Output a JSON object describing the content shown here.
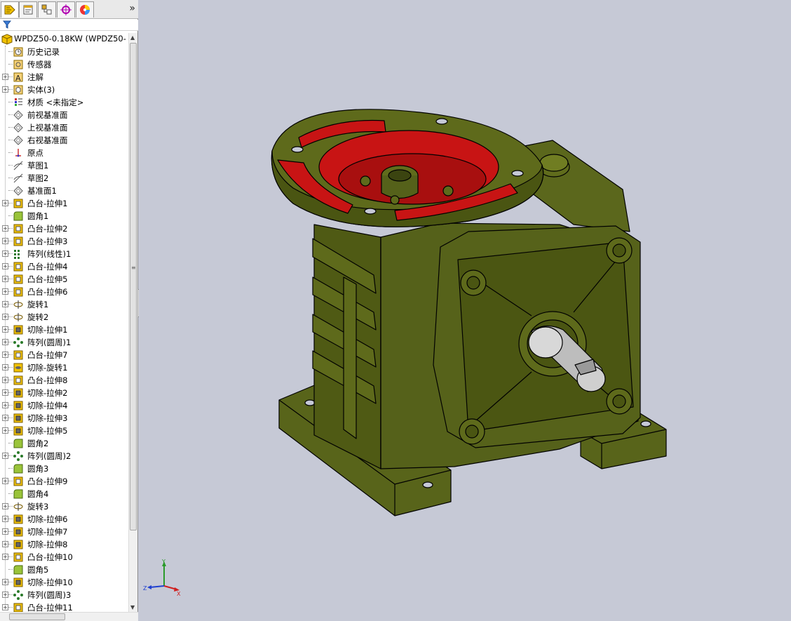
{
  "tabs": [
    {
      "name": "feature-manager",
      "icon": "feature-tree-icon"
    },
    {
      "name": "property-manager",
      "icon": "property-manager-icon"
    },
    {
      "name": "configuration-manager",
      "icon": "configuration-manager-icon"
    },
    {
      "name": "dimxpert-manager",
      "icon": "dimxpert-icon"
    },
    {
      "name": "display-manager",
      "icon": "display-manager-icon"
    }
  ],
  "tabs_more": "»",
  "filter_icon": "filter-icon",
  "tree": {
    "root": {
      "label": "WPDZ50-0.18KW  (WPDZ50-",
      "icon": "part-icon"
    },
    "items": [
      {
        "label": "历史记录",
        "icon": "history-icon",
        "expandable": false
      },
      {
        "label": "传感器",
        "icon": "sensor-icon",
        "expandable": false
      },
      {
        "label": "注解",
        "icon": "annotation-icon",
        "expandable": true
      },
      {
        "label": "实体(3)",
        "icon": "solid-bodies-icon",
        "expandable": true
      },
      {
        "label": "材质 <未指定>",
        "icon": "material-icon",
        "expandable": false
      },
      {
        "label": "前视基准面",
        "icon": "plane-icon",
        "expandable": false
      },
      {
        "label": "上视基准面",
        "icon": "plane-icon",
        "expandable": false
      },
      {
        "label": "右视基准面",
        "icon": "plane-icon",
        "expandable": false
      },
      {
        "label": "原点",
        "icon": "origin-icon",
        "expandable": false
      },
      {
        "label": "草图1",
        "icon": "sketch-icon",
        "expandable": false
      },
      {
        "label": "草图2",
        "icon": "sketch-icon",
        "expandable": false
      },
      {
        "label": "基准面1",
        "icon": "plane-icon",
        "expandable": false
      },
      {
        "label": "凸台-拉伸1",
        "icon": "boss-extrude-icon",
        "expandable": true
      },
      {
        "label": "圆角1",
        "icon": "fillet-icon",
        "expandable": false
      },
      {
        "label": "凸台-拉伸2",
        "icon": "boss-extrude-icon",
        "expandable": true
      },
      {
        "label": "凸台-拉伸3",
        "icon": "boss-extrude-icon",
        "expandable": true
      },
      {
        "label": "阵列(线性)1",
        "icon": "linear-pattern-icon",
        "expandable": true
      },
      {
        "label": "凸台-拉伸4",
        "icon": "boss-extrude-icon",
        "expandable": true
      },
      {
        "label": "凸台-拉伸5",
        "icon": "boss-extrude-icon",
        "expandable": true
      },
      {
        "label": "凸台-拉伸6",
        "icon": "boss-extrude-icon",
        "expandable": true
      },
      {
        "label": "旋转1",
        "icon": "revolve-icon",
        "expandable": true
      },
      {
        "label": "旋转2",
        "icon": "revolve-icon",
        "expandable": true
      },
      {
        "label": "切除-拉伸1",
        "icon": "cut-extrude-icon",
        "expandable": true
      },
      {
        "label": "阵列(圆周)1",
        "icon": "circular-pattern-icon",
        "expandable": true
      },
      {
        "label": "凸台-拉伸7",
        "icon": "boss-extrude-icon",
        "expandable": true
      },
      {
        "label": "切除-旋转1",
        "icon": "cut-revolve-icon",
        "expandable": true
      },
      {
        "label": "凸台-拉伸8",
        "icon": "boss-extrude-icon",
        "expandable": true
      },
      {
        "label": "切除-拉伸2",
        "icon": "cut-extrude-icon",
        "expandable": true
      },
      {
        "label": "切除-拉伸4",
        "icon": "cut-extrude-icon",
        "expandable": true
      },
      {
        "label": "切除-拉伸3",
        "icon": "cut-extrude-icon",
        "expandable": true
      },
      {
        "label": "切除-拉伸5",
        "icon": "cut-extrude-icon",
        "expandable": true
      },
      {
        "label": "圆角2",
        "icon": "fillet-icon",
        "expandable": false
      },
      {
        "label": "阵列(圆周)2",
        "icon": "circular-pattern-icon",
        "expandable": true
      },
      {
        "label": "圆角3",
        "icon": "fillet-icon",
        "expandable": false
      },
      {
        "label": "凸台-拉伸9",
        "icon": "boss-extrude-icon",
        "expandable": true
      },
      {
        "label": "圆角4",
        "icon": "fillet-icon",
        "expandable": false
      },
      {
        "label": "旋转3",
        "icon": "revolve-icon",
        "expandable": true
      },
      {
        "label": "切除-拉伸6",
        "icon": "cut-extrude-icon",
        "expandable": true
      },
      {
        "label": "切除-拉伸7",
        "icon": "cut-extrude-icon",
        "expandable": true
      },
      {
        "label": "切除-拉伸8",
        "icon": "cut-extrude-icon",
        "expandable": true
      },
      {
        "label": "凸台-拉伸10",
        "icon": "boss-extrude-icon",
        "expandable": true
      },
      {
        "label": "圆角5",
        "icon": "fillet-icon",
        "expandable": false
      },
      {
        "label": "切除-拉伸10",
        "icon": "cut-extrude-icon",
        "expandable": true
      },
      {
        "label": "阵列(圆周)3",
        "icon": "circular-pattern-icon",
        "expandable": true
      },
      {
        "label": "凸台-拉伸11",
        "icon": "boss-extrude-icon",
        "expandable": true
      }
    ]
  },
  "triad": {
    "x": "X",
    "y": "Y",
    "z": "Z"
  },
  "colors": {
    "viewport_bg": "#c6c9d6",
    "body_green": "#4f5a14",
    "body_green_light": "#66731d",
    "cavity_red": "#c81414",
    "shaft_gray": "#c8c8c8",
    "edge": "#000000"
  }
}
